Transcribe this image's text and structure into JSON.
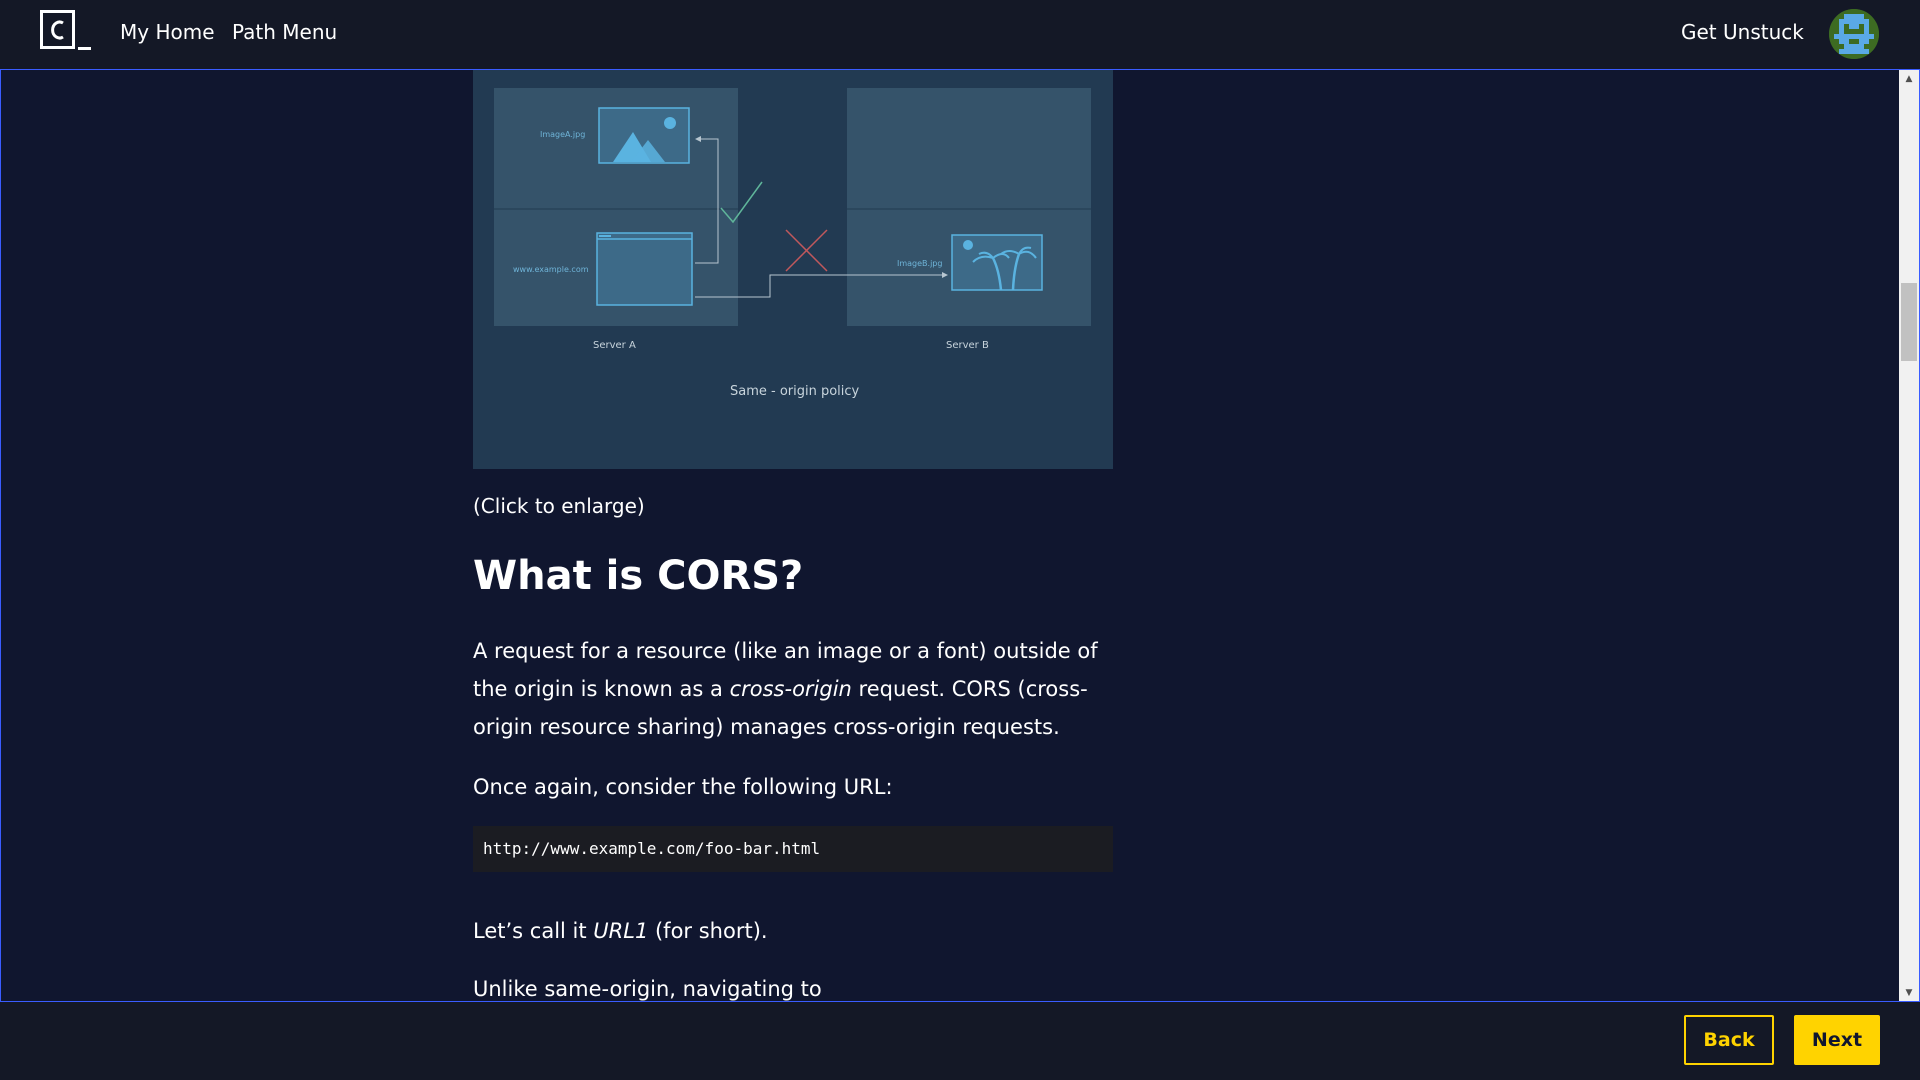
{
  "topbar": {
    "nav_home": "My Home",
    "nav_path_menu": "Path Menu",
    "get_unstuck": "Get Unstuck"
  },
  "diagram": {
    "file_a": "ImageA.jpg",
    "file_b": "ImageB.jpg",
    "site": "www.example.com",
    "server_a": "Server A",
    "server_b": "Server B",
    "caption": "Same - origin policy"
  },
  "article": {
    "click_to_enlarge": "(Click to enlarge)",
    "heading": "What is CORS?",
    "para1": {
      "t1": "A request for a resource (like an image or a font) outside of the origin is known as a ",
      "em": "cross-origin",
      "t2": " request. CORS (cross-origin resource sharing) manages cross-origin requests."
    },
    "para2": "Once again, consider the following URL:",
    "code": "http://www.example.com/foo-bar.html",
    "para3": {
      "t1": "Let’s call it ",
      "em": "URL1",
      "t2": " (for short)."
    },
    "para4": "Unlike same-origin, navigating to"
  },
  "footer": {
    "back_label": "Back",
    "next_label": "Next"
  },
  "colors": {
    "accent": "#ffd300",
    "background": "#10162f",
    "bar": "#141826",
    "frame_border": "#3a5cff"
  }
}
